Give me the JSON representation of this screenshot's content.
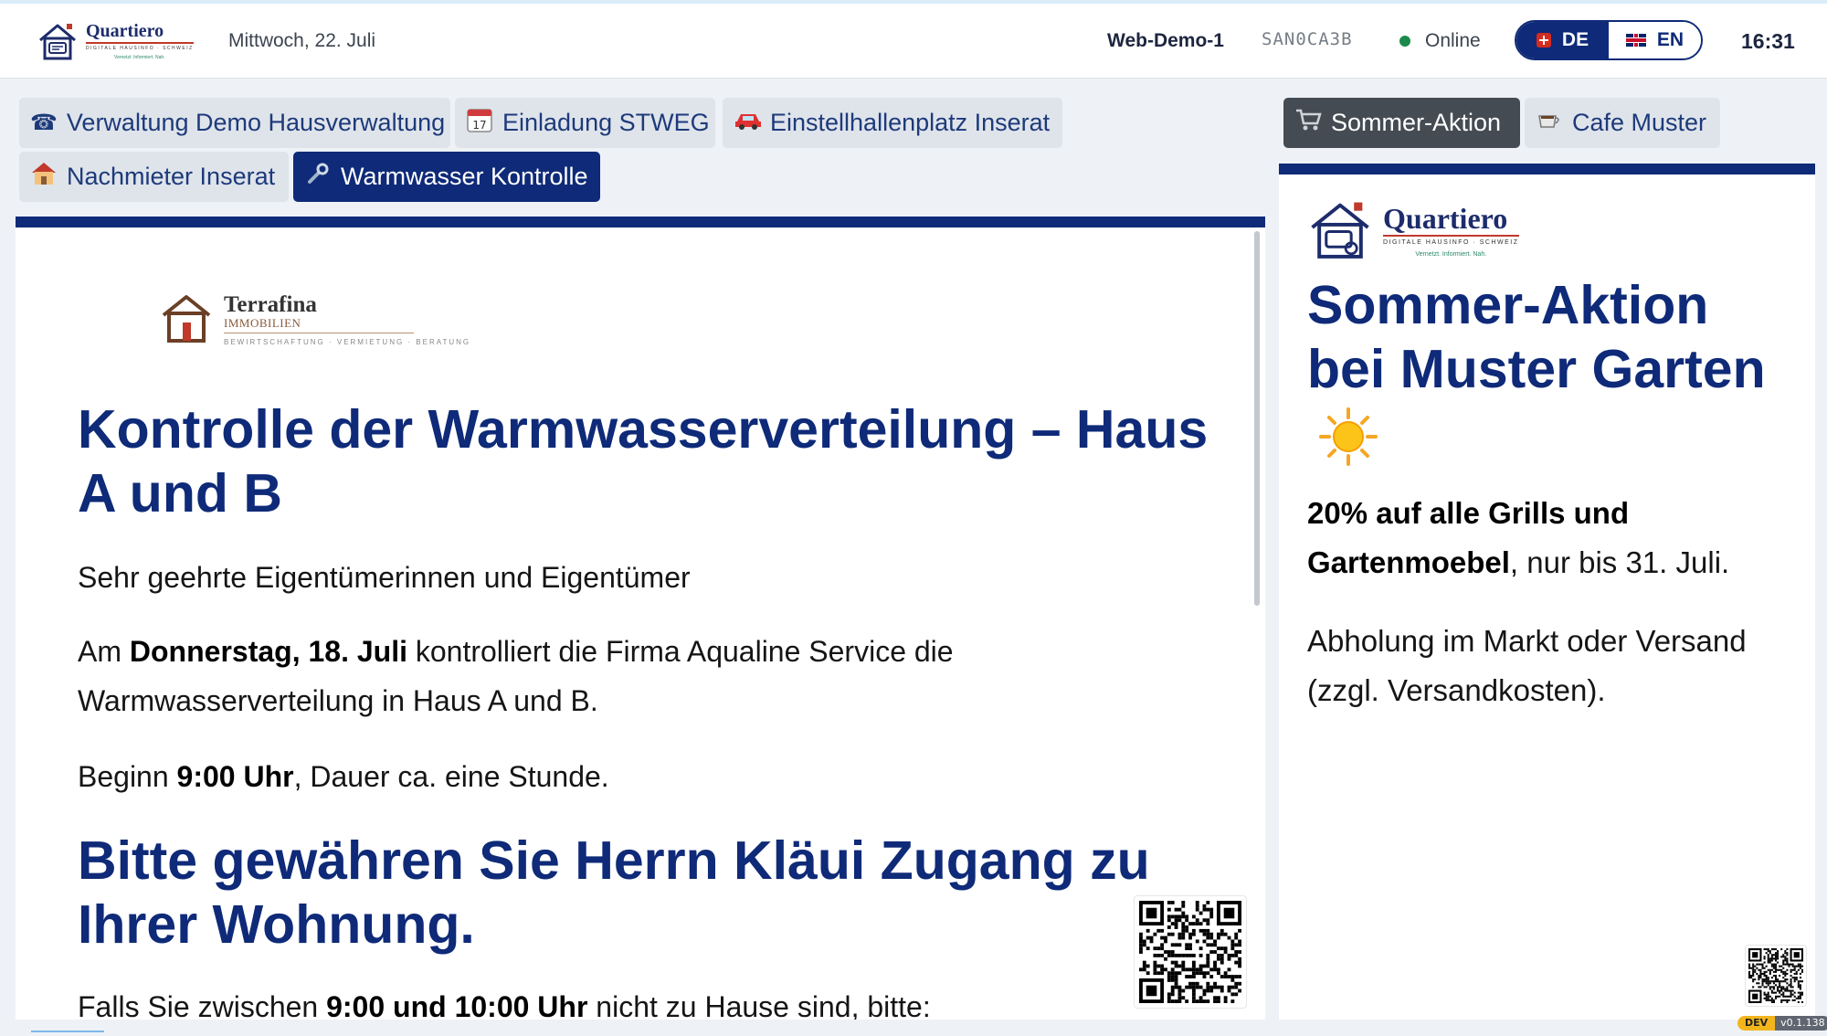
{
  "header": {
    "brand": "Quartiero",
    "brand_sub": "DIGITALE HAUSINFO · SCHWEIZ",
    "brand_tag": "Vernetzt. Informiert. Nah.",
    "date": "Mittwoch, 22. Juli",
    "device": "Web-Demo-1",
    "code": "SAN0CA3B",
    "status": "Online",
    "status_color": "#1b8a4b",
    "lang_de": "DE",
    "lang_en": "EN",
    "time": "16:31"
  },
  "tabs": [
    {
      "label": "Verwaltung Demo Hausverwaltung",
      "icon": "telephone-icon"
    },
    {
      "label": "Einladung STWEG",
      "icon": "calendar-icon"
    },
    {
      "label": "Einstellhallenplatz Inserat",
      "icon": "car-icon"
    },
    {
      "label": "Nachmieter Inserat",
      "icon": "house-icon"
    },
    {
      "label": "Warmwasser Kontrolle",
      "icon": "wrench-icon",
      "active": true
    }
  ],
  "side_tabs": [
    {
      "label": "Sommer-Aktion",
      "icon": "shopping-cart-icon",
      "active": true
    },
    {
      "label": "Cafe Muster",
      "icon": "coffee-icon"
    }
  ],
  "main": {
    "logo_name": "Terrafina",
    "logo_sub": "IMMOBILIEN",
    "logo_tag": "BEWIRTSCHAFTUNG · VERMIETUNG · BERATUNG",
    "title": "Kontrolle der Warmwasserverteilung – Haus A und B",
    "greeting": "Sehr geehrte Eigentümerinnen und Eigentümer",
    "p1_pre": "Am ",
    "p1_bold": "Donnerstag, 18. Juli",
    "p1_post": " kontrolliert die Firma Aqualine Service die Warmwasserverteilung in Haus A und B.",
    "p2_pre": "Beginn ",
    "p2_bold": "9:00 Uhr",
    "p2_post": ", Dauer ca. eine Stunde.",
    "subtitle": "Bitte gewähren Sie Herrn Kläui Zugang zu Ihrer Wohnung.",
    "p3_pre": "Falls Sie zwischen ",
    "p3_bold": "9:00 und 10:00 Uhr",
    "p3_post": " nicht zu Hause sind, bitte:"
  },
  "side": {
    "brand": "Quartiero",
    "brand_sub": "DIGITALE HAUSINFO · SCHWEIZ",
    "brand_tag": "Vernetzt. Informiert. Nah.",
    "title": "Sommer-Aktion bei Muster Garten",
    "p1_bold": "20% auf alle Grills und Gartenmoebel",
    "p1_post": ", nur bis 31. Juli.",
    "p2": "Abholung im Markt oder Versand (zzgl. Versandkosten)."
  },
  "footer": {
    "dev_badge": "DEV",
    "version": "v0.1.138"
  },
  "colors": {
    "accent": "#0e2a78",
    "tab_bg": "#dfe4eb",
    "side_tab_active": "#454b52"
  }
}
